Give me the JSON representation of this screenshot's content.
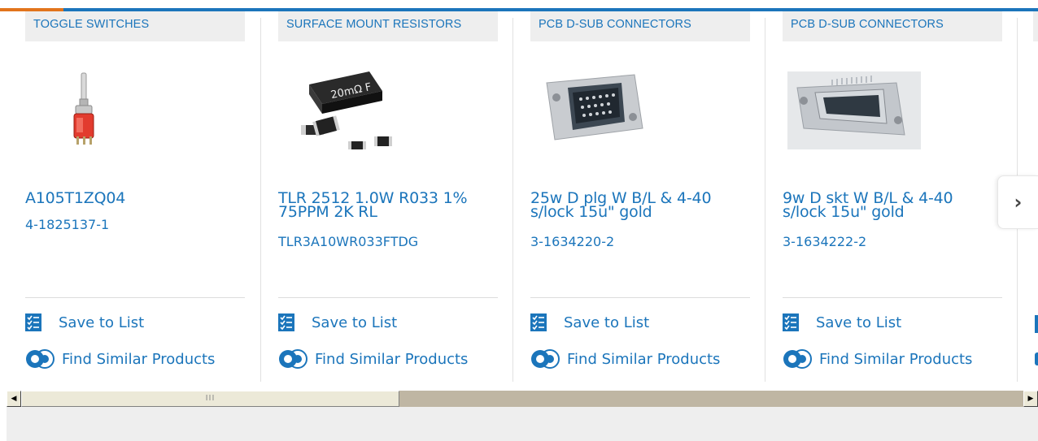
{
  "colors": {
    "brand_blue": "#1b75bb",
    "accent_orange": "#e2741c",
    "category_bg": "#eeeeee"
  },
  "actions": {
    "save_label": "Save to List",
    "find_label": "Find Similar Products"
  },
  "products": [
    {
      "category": "TOGGLE SWITCHES",
      "title_line1": "A105T1ZQ04",
      "title_line2": "",
      "part_number": "4-1825137-1",
      "image": "toggle-switch"
    },
    {
      "category": "SURFACE MOUNT RESISTORS",
      "title_line1": "TLR 2512 1.0W R033 1%",
      "title_line2": "75PPM 2K RL",
      "part_number": "TLR3A10WR033FTDG",
      "image": "smd-resistor",
      "image_text": "20mΩ F"
    },
    {
      "category": "PCB D-SUB CONNECTORS",
      "title_line1": "25w D plg W B/L & 4-40",
      "title_line2": "s/lock 15u\" gold",
      "part_number": "3-1634220-2",
      "image": "dsub-plug"
    },
    {
      "category": "PCB D-SUB CONNECTORS",
      "title_line1": "9w D skt W B/L & 4-40",
      "title_line2": "s/lock 15u\" gold",
      "part_number": "3-1634222-2",
      "image": "dsub-socket"
    }
  ],
  "carousel": {
    "next_icon": "chevron-right-icon",
    "next_symbol": "›"
  },
  "scrollbar": {
    "left_arrow": "◀",
    "right_arrow": "▶",
    "thumb_grip": "III"
  }
}
